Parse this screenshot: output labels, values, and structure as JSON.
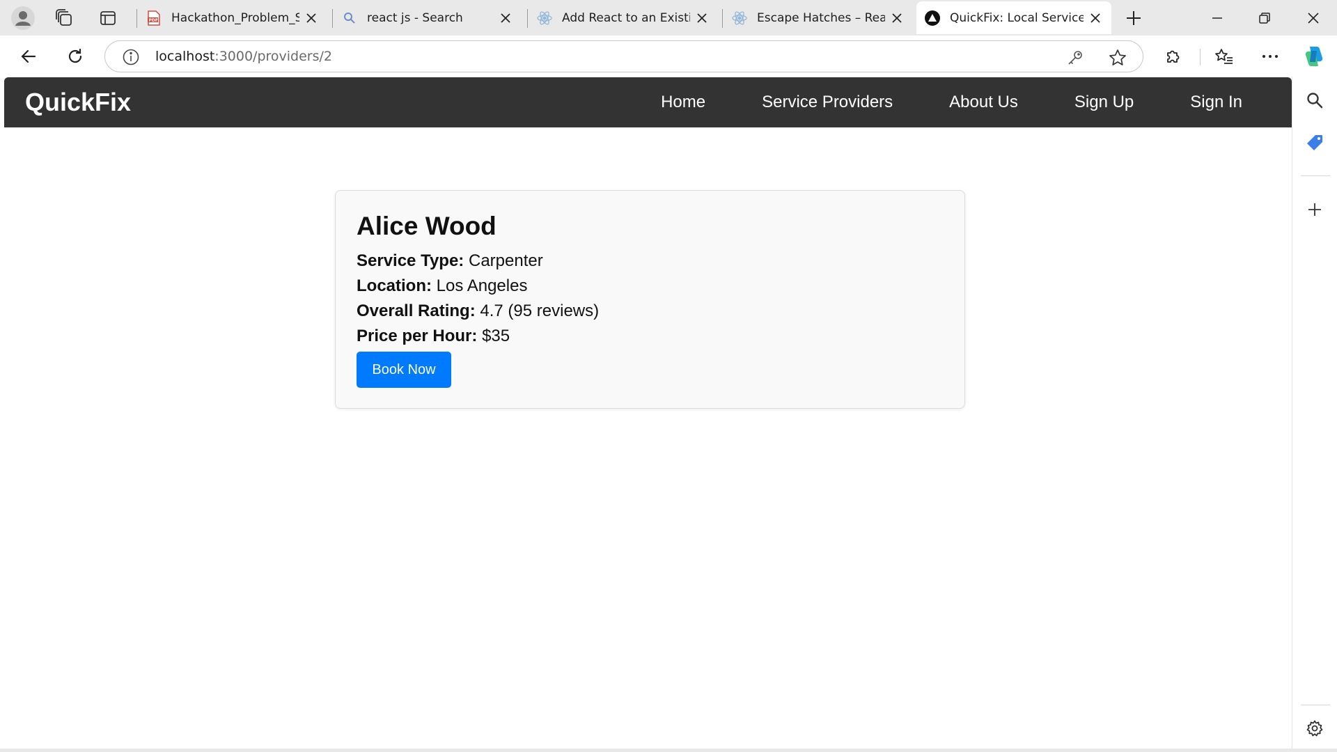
{
  "browser": {
    "tabs": [
      {
        "title": "Hackathon_Problem_Sta",
        "favicon": "pdf-icon"
      },
      {
        "title": "react js - Search",
        "favicon": "search-icon"
      },
      {
        "title": "Add React to an Existing",
        "favicon": "react-icon"
      },
      {
        "title": "Escape Hatches – React",
        "favicon": "react-icon"
      },
      {
        "title": "QuickFix: Local Service P",
        "favicon": "app-logo-icon",
        "active": true
      }
    ],
    "address": {
      "host": "localhost",
      "path": ":3000/providers/2"
    },
    "accent_color": "#0078d4"
  },
  "site": {
    "brand": "QuickFix",
    "nav": {
      "home": "Home",
      "providers": "Service Providers",
      "about": "About Us",
      "signup": "Sign Up",
      "signin": "Sign In"
    },
    "nav_bg_color": "#333333"
  },
  "provider": {
    "name": "Alice Wood",
    "service_type_label": "Service Type:",
    "service_type": "Carpenter",
    "location_label": "Location:",
    "location": "Los Angeles",
    "rating_label": "Overall Rating:",
    "rating": "4.7 (95 reviews)",
    "price_label": "Price per Hour:",
    "price": "$35",
    "book_button": "Book Now",
    "button_color": "#007bff"
  }
}
